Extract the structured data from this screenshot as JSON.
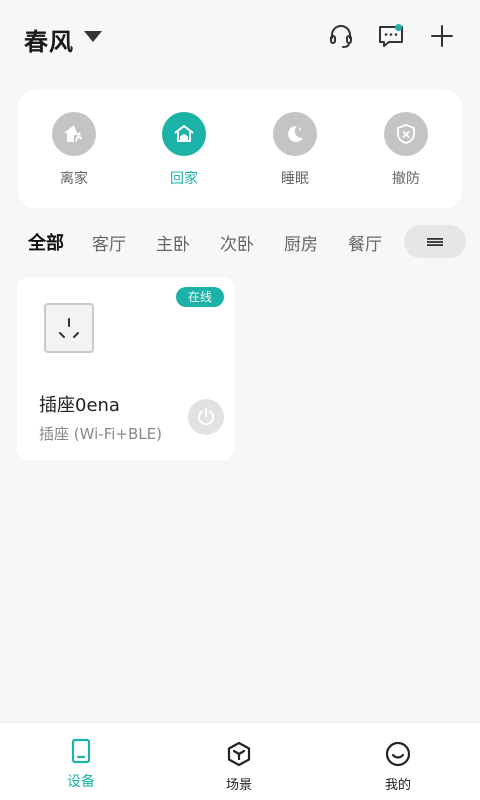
{
  "header": {
    "home_name": "春风",
    "icons": [
      "headset-icon",
      "message-icon",
      "plus-icon"
    ],
    "message_unread": true
  },
  "scenes": [
    {
      "label": "离家",
      "icon": "leave-home-icon",
      "active": false
    },
    {
      "label": "回家",
      "icon": "home-icon",
      "active": true
    },
    {
      "label": "睡眠",
      "icon": "moon-icon",
      "active": false
    },
    {
      "label": "撤防",
      "icon": "disarm-shield-icon",
      "active": false
    }
  ],
  "rooms": {
    "tabs": [
      "全部",
      "客厅",
      "主卧",
      "次卧",
      "厨房",
      "餐厅"
    ],
    "active_index": 0,
    "menu_icon": "menu-icon"
  },
  "devices": [
    {
      "status": "在线",
      "name": "插座0ena",
      "type": "插座 (Wi-Fi+BLE)",
      "icon": "socket-icon",
      "power_on": false
    }
  ],
  "bottom_nav": [
    {
      "label": "设备",
      "icon": "device-icon",
      "active": true
    },
    {
      "label": "场景",
      "icon": "scene-cube-icon",
      "active": false
    },
    {
      "label": "我的",
      "icon": "smile-icon",
      "active": false
    }
  ],
  "colors": {
    "accent": "#1bb3a7",
    "inactive_circle": "#c4c4c4",
    "background": "#f7f7f7"
  }
}
